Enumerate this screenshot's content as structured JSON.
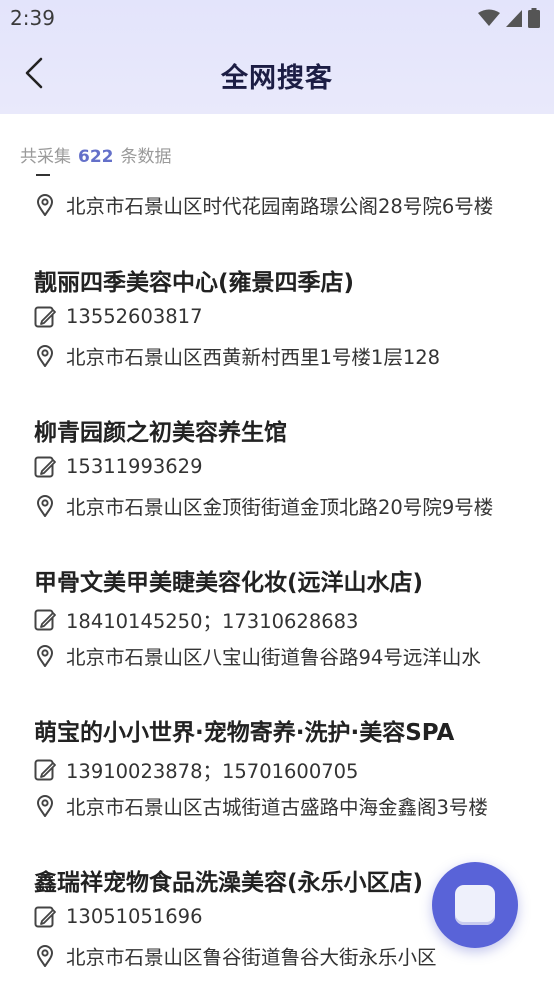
{
  "status_bar": {
    "time": "2:39"
  },
  "header": {
    "title": "全网搜客"
  },
  "summary": {
    "prefix": "共采集",
    "count": "622",
    "suffix": "条数据"
  },
  "partial_item": {
    "address": "北京市石景山区时代花园南路璟公阁28号院6号楼"
  },
  "items": [
    {
      "name": "靓丽四季美容中心(雍景四季店)",
      "phone": "13552603817",
      "address": "北京市石景山区西黄新村西里1号楼1层128"
    },
    {
      "name": "柳青园颜之初美容养生馆",
      "phone": "15311993629",
      "address": "北京市石景山区金顶街街道金顶北路20号院9号楼"
    },
    {
      "name": "甲骨文美甲美睫美容化妆(远洋山水店)",
      "phone": "18410145250；17310628683",
      "address": "北京市石景山区八宝山街道鲁谷路94号远洋山水"
    },
    {
      "name": "萌宝的小小世界·宠物寄养·洗护·美容SPA",
      "phone": "13910023878；15701600705",
      "address": "北京市石景山区古城街道古盛路中海金鑫阁3号楼"
    },
    {
      "name": "鑫瑞祥宠物食品洗澡美容(永乐小区店)",
      "phone": "13051051696",
      "address": "北京市石景山区鲁谷街道鲁谷大街永乐小区"
    }
  ],
  "icons": {
    "back": "chevron-left-icon",
    "phone": "note-edit-icon",
    "address": "location-pin-icon",
    "fab": "floating-assistant-icon",
    "wifi": "wifi-icon",
    "signal": "signal-icon",
    "battery": "battery-icon"
  },
  "colors": {
    "accent": "#6470c9",
    "header_bg": "#e3e4fb",
    "fab": "#5963d8"
  }
}
